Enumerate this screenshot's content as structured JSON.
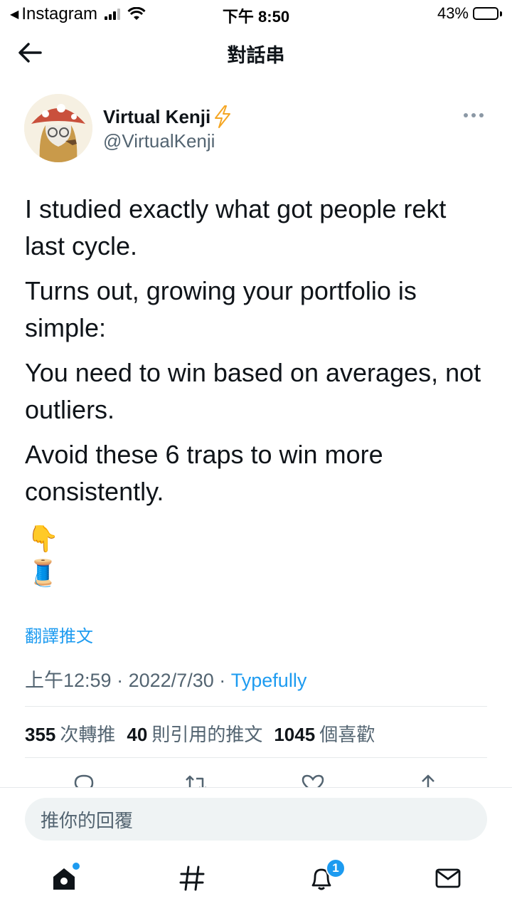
{
  "status_bar": {
    "back_app": "Instagram",
    "time": "下午 8:50",
    "battery": "43%",
    "battery_level": 0.43
  },
  "header": {
    "title": "對話串"
  },
  "tweet": {
    "author": {
      "name": "Virtual Kenji",
      "handle": "@VirtualKenji"
    },
    "paragraphs": [
      "I studied exactly what got people rekt last cycle.",
      "Turns out, growing your portfolio is simple:",
      "You need to win based on averages, not outliers.",
      "Avoid these 6 traps to win more consistently."
    ],
    "emoji_hand": "👇",
    "emoji_spool": "🧵",
    "translate_label": "翻譯推文",
    "time": "上午12:59",
    "date": "2022/7/30",
    "separator": "·",
    "source": "Typefully"
  },
  "stats": {
    "retweets_count": "355",
    "retweets_label": "次轉推",
    "quotes_count": "40",
    "quotes_label": "則引用的推文",
    "likes_count": "1045",
    "likes_label": "個喜歡"
  },
  "reply": {
    "placeholder": "推你的回覆"
  },
  "tab_bar": {
    "notifications_badge": "1"
  },
  "colors": {
    "accent": "#1d9bf0",
    "text": "#0f1419",
    "secondary": "#536471"
  }
}
